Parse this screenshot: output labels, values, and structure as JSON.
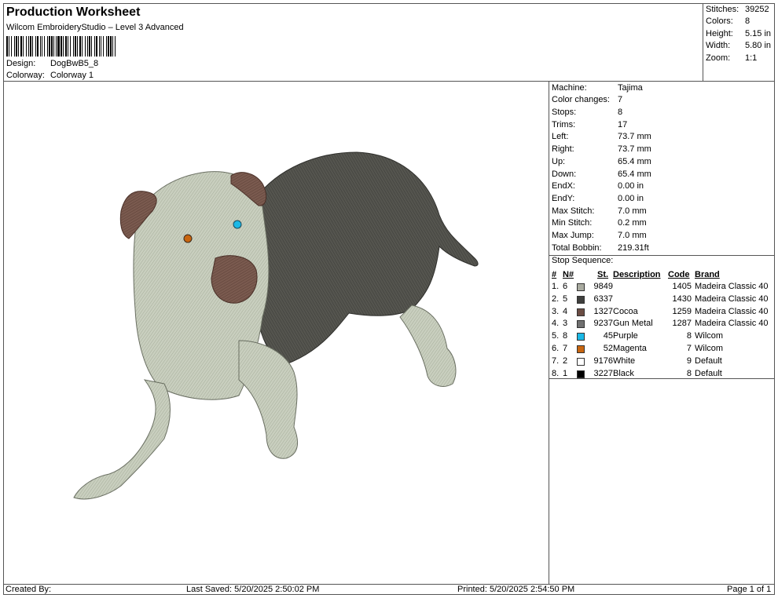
{
  "header": {
    "title": "Production Worksheet",
    "subtitle": "Wilcom EmbroideryStudio – Level 3 Advanced",
    "design_label": "Design:",
    "design_value": "DogBwB5_8",
    "colorway_label": "Colorway:",
    "colorway_value": "Colorway 1"
  },
  "stats": [
    {
      "label": "Stitches:",
      "value": "39252"
    },
    {
      "label": "Colors:",
      "value": "8"
    },
    {
      "label": "Height:",
      "value": "5.15 in"
    },
    {
      "label": "Width:",
      "value": "5.80 in"
    },
    {
      "label": "Zoom:",
      "value": "1:1"
    }
  ],
  "machine_info": [
    {
      "label": "Machine:",
      "value": "Tajima"
    },
    {
      "label": "Color changes:",
      "value": "7"
    },
    {
      "label": "Stops:",
      "value": "8"
    },
    {
      "label": "Trims:",
      "value": "17"
    },
    {
      "label": "Left:",
      "value": "73.7 mm"
    },
    {
      "label": "Right:",
      "value": "73.7 mm"
    },
    {
      "label": "Up:",
      "value": "65.4 mm"
    },
    {
      "label": "Down:",
      "value": "65.4 mm"
    },
    {
      "label": "EndX:",
      "value": "0.00 in"
    },
    {
      "label": "EndY:",
      "value": "0.00 in"
    },
    {
      "label": "Max Stitch:",
      "value": "7.0 mm"
    },
    {
      "label": "Min Stitch:",
      "value": "0.2 mm"
    },
    {
      "label": "Max Jump:",
      "value": "7.0 mm"
    },
    {
      "label": "Total Bobbin:",
      "value": "219.31ft"
    }
  ],
  "stop_sequence": {
    "title": "Stop Sequence:",
    "headers": {
      "stop": "#",
      "needle": "N#",
      "st": "St.",
      "description": "Description",
      "code": "Code",
      "brand": "Brand"
    },
    "rows": [
      {
        "stop": "1.",
        "needle": "6",
        "color": "#a9aba0",
        "st": "9849",
        "description": "",
        "code": "1405",
        "brand": "Madeira Classic 40"
      },
      {
        "stop": "2.",
        "needle": "5",
        "color": "#3f3f3d",
        "st": "6337",
        "description": "",
        "code": "1430",
        "brand": "Madeira Classic 40"
      },
      {
        "stop": "3.",
        "needle": "4",
        "color": "#6b4d44",
        "st": "1327",
        "description": "Cocoa",
        "code": "1259",
        "brand": "Madeira Classic 40"
      },
      {
        "stop": "4.",
        "needle": "3",
        "color": "#707070",
        "st": "9237",
        "description": "Gun Metal",
        "code": "1287",
        "brand": "Madeira Classic 40"
      },
      {
        "stop": "5.",
        "needle": "8",
        "color": "#1ab8e6",
        "st": "45",
        "description": "Purple",
        "code": "8",
        "brand": "Wilcom"
      },
      {
        "stop": "6.",
        "needle": "7",
        "color": "#c8650f",
        "st": "52",
        "description": "Magenta",
        "code": "7",
        "brand": "Wilcom"
      },
      {
        "stop": "7.",
        "needle": "2",
        "color": "#ffffff",
        "st": "9176",
        "description": "White",
        "code": "9",
        "brand": "Default"
      },
      {
        "stop": "8.",
        "needle": "1",
        "color": "#000000",
        "st": "3227",
        "description": "Black",
        "code": "8",
        "brand": "Default"
      }
    ]
  },
  "footer": {
    "created_by": "Created By:",
    "last_saved": "Last Saved: 5/20/2025 2:50:02 PM",
    "printed": "Printed: 5/20/2025 2:54:50 PM",
    "page": "Page 1 of 1"
  }
}
